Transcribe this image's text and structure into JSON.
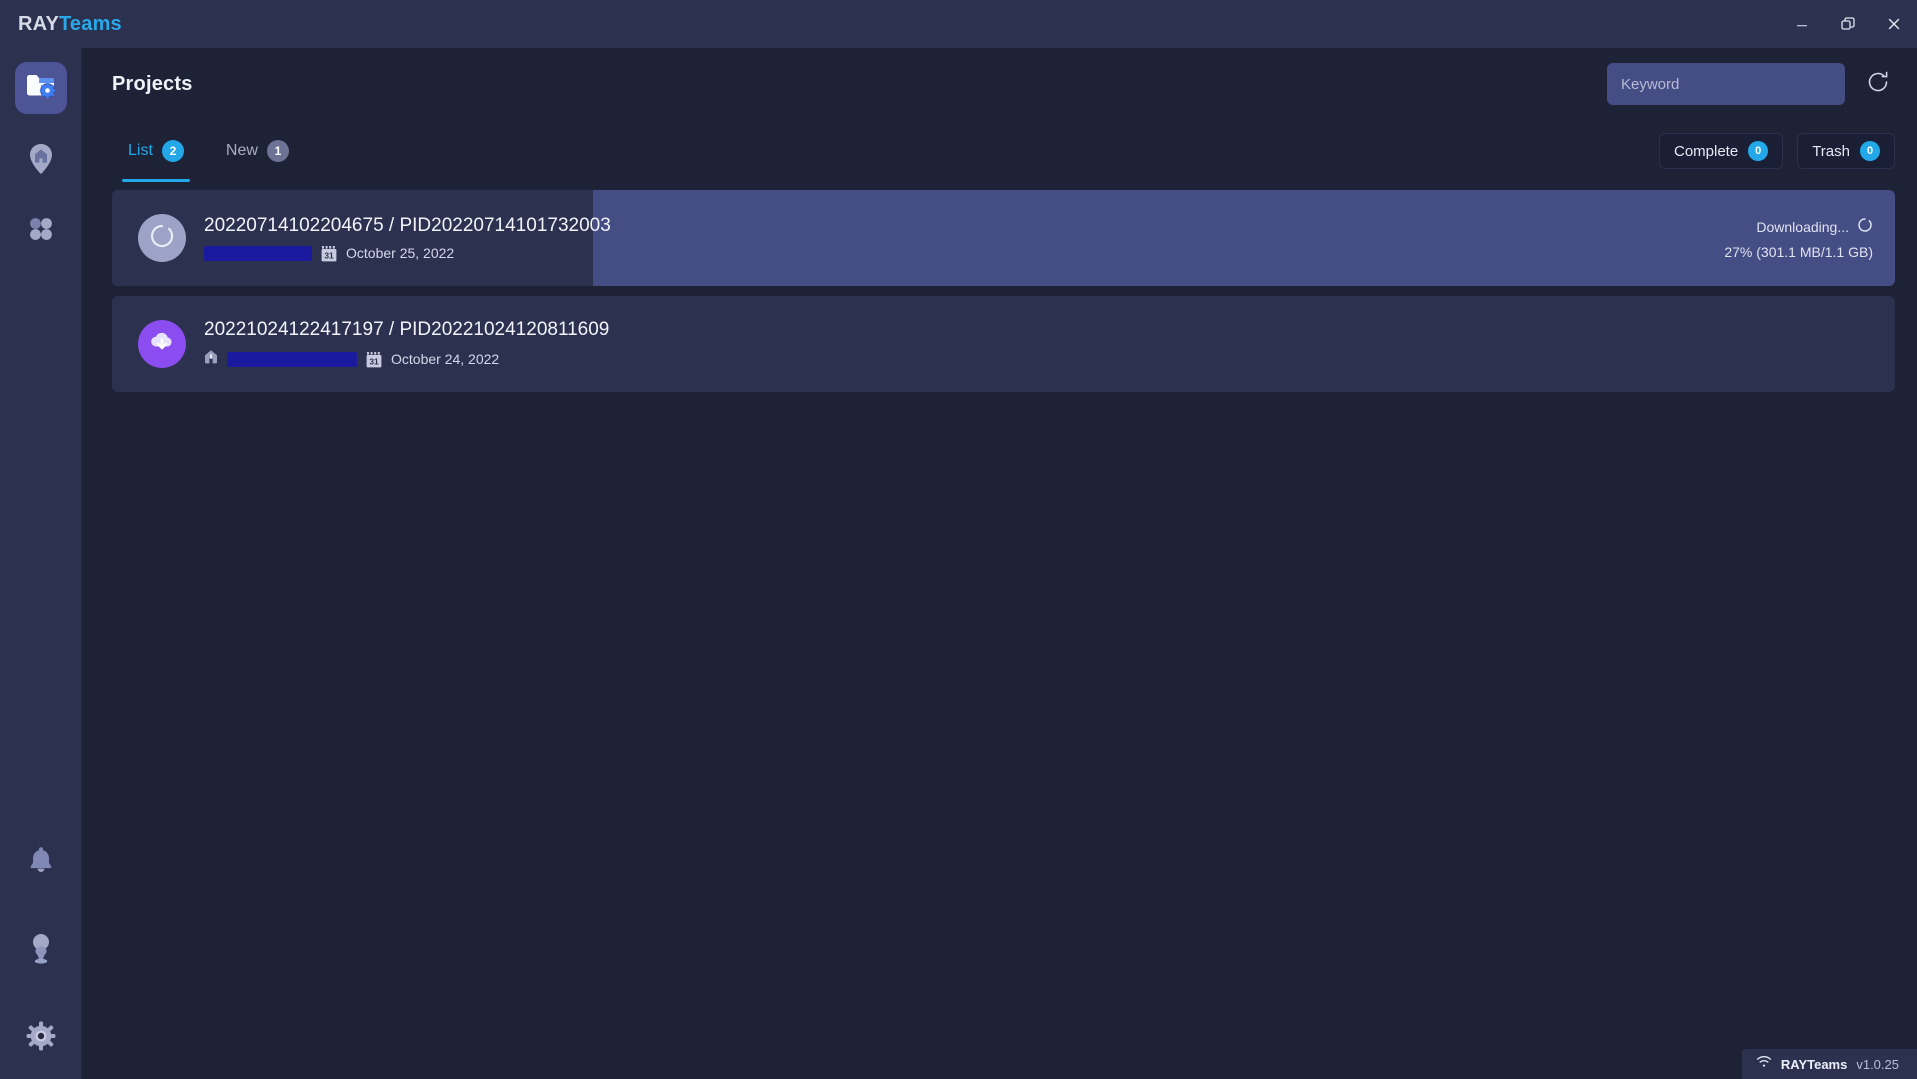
{
  "window": {
    "logo_ray": "RAY",
    "logo_teams": "Teams",
    "minimize_label": "Minimize",
    "restore_label": "Restore",
    "close_label": "Close"
  },
  "sidebar": {
    "items": [
      {
        "name": "projects",
        "icon": "folder-gear-icon",
        "active": true
      },
      {
        "name": "location",
        "icon": "map-pin-home-icon",
        "active": false
      },
      {
        "name": "apps",
        "icon": "grid-dots-icon",
        "active": false
      }
    ],
    "bottom_items": [
      {
        "name": "notifications",
        "icon": "bell-icon"
      },
      {
        "name": "account",
        "icon": "user-icon"
      },
      {
        "name": "settings",
        "icon": "gear-icon"
      }
    ]
  },
  "header": {
    "title": "Projects",
    "search_placeholder": "Keyword",
    "search_value": "",
    "refresh_icon": "refresh-icon"
  },
  "tabs": [
    {
      "label": "List",
      "count": "2",
      "active": true
    },
    {
      "label": "New",
      "count": "1",
      "active": false
    }
  ],
  "actions": [
    {
      "label": "Complete",
      "count": "0"
    },
    {
      "label": "Trash",
      "count": "0"
    }
  ],
  "projects": [
    {
      "title": "20220714102204675 / PID20220714101732003",
      "date": "October 25, 2022",
      "redacted_name": "",
      "avatar_icon": "spinner-icon",
      "state": "downloading",
      "status_text": "Downloading...",
      "status_detail": "27% (301.1 MB/1.1 GB)",
      "progress_percent": 27,
      "has_home_icon": false
    },
    {
      "title": "20221024122417197 / PID20221024120811609",
      "date": "October 24, 2022",
      "redacted_name": "",
      "avatar_icon": "cloud-download-icon",
      "state": "ready",
      "status_text": "",
      "status_detail": "",
      "progress_percent": 0,
      "has_home_icon": true
    }
  ],
  "statusbar": {
    "wifi_icon": "wifi-icon",
    "app_name": "RAYTeams",
    "version": "v1.0.25"
  },
  "colors": {
    "accent_cyan": "#22a8e8",
    "window_chrome": "#2c3150",
    "page_bg": "#1e2236",
    "row_downloading": "#454d85",
    "avatar_purple": "#8b4df0",
    "redaction": "#1a1a9e"
  }
}
